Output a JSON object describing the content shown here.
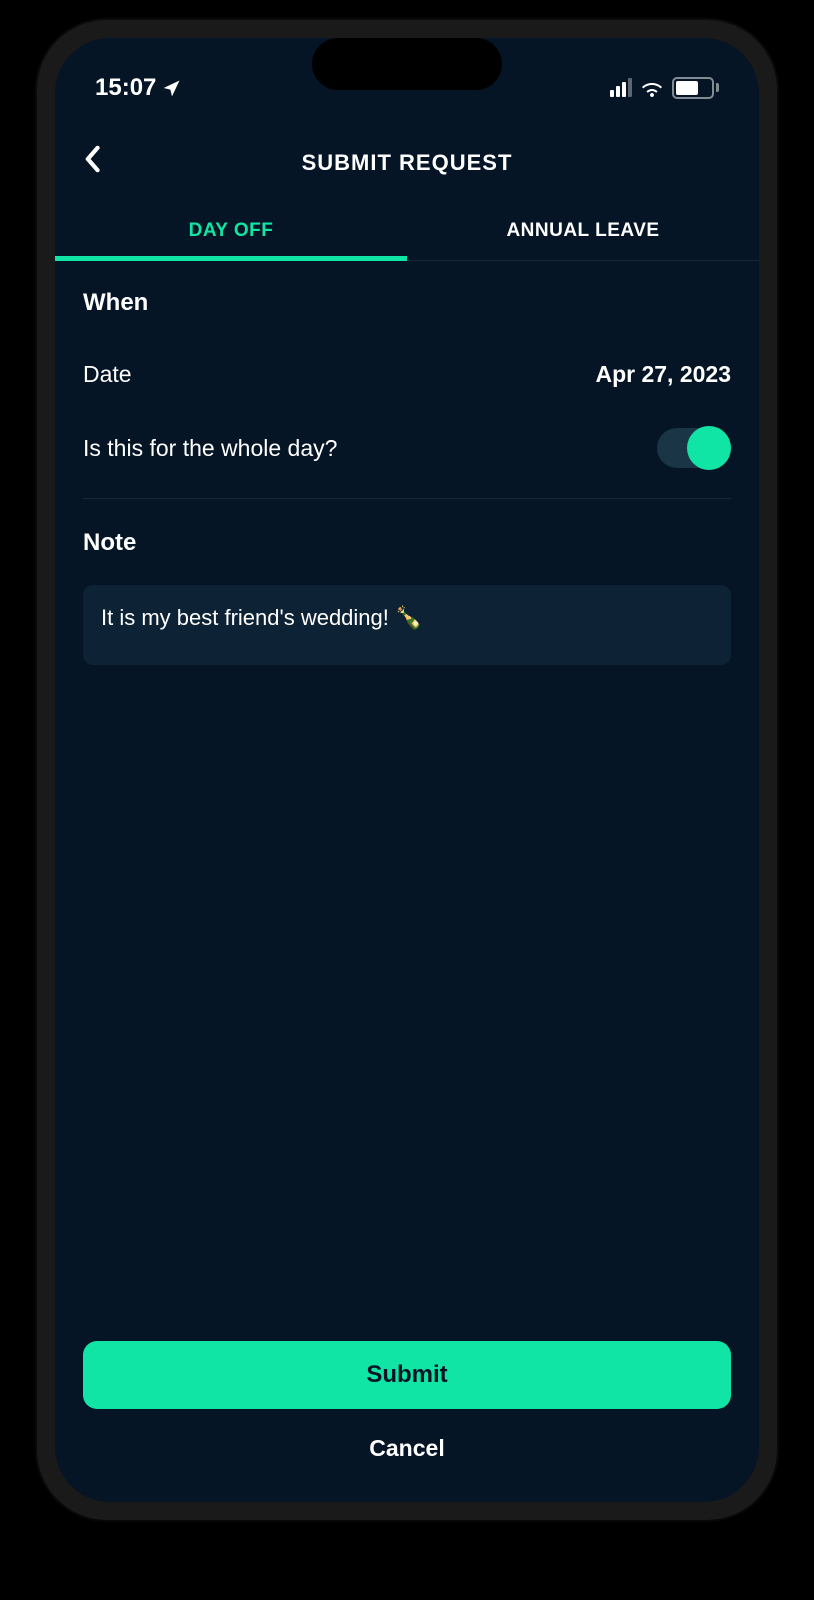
{
  "status": {
    "time": "15:07",
    "battery": "58"
  },
  "header": {
    "title": "SUBMIT REQUEST"
  },
  "tabs": {
    "day_off": "DAY OFF",
    "annual_leave": "ANNUAL LEAVE"
  },
  "form": {
    "when_label": "When",
    "date_label": "Date",
    "date_value": "Apr 27, 2023",
    "whole_day_label": "Is this for the whole day?",
    "whole_day_enabled": true,
    "note_label": "Note",
    "note_value": "It is my best friend's wedding! 🍾"
  },
  "actions": {
    "submit": "Submit",
    "cancel": "Cancel"
  }
}
